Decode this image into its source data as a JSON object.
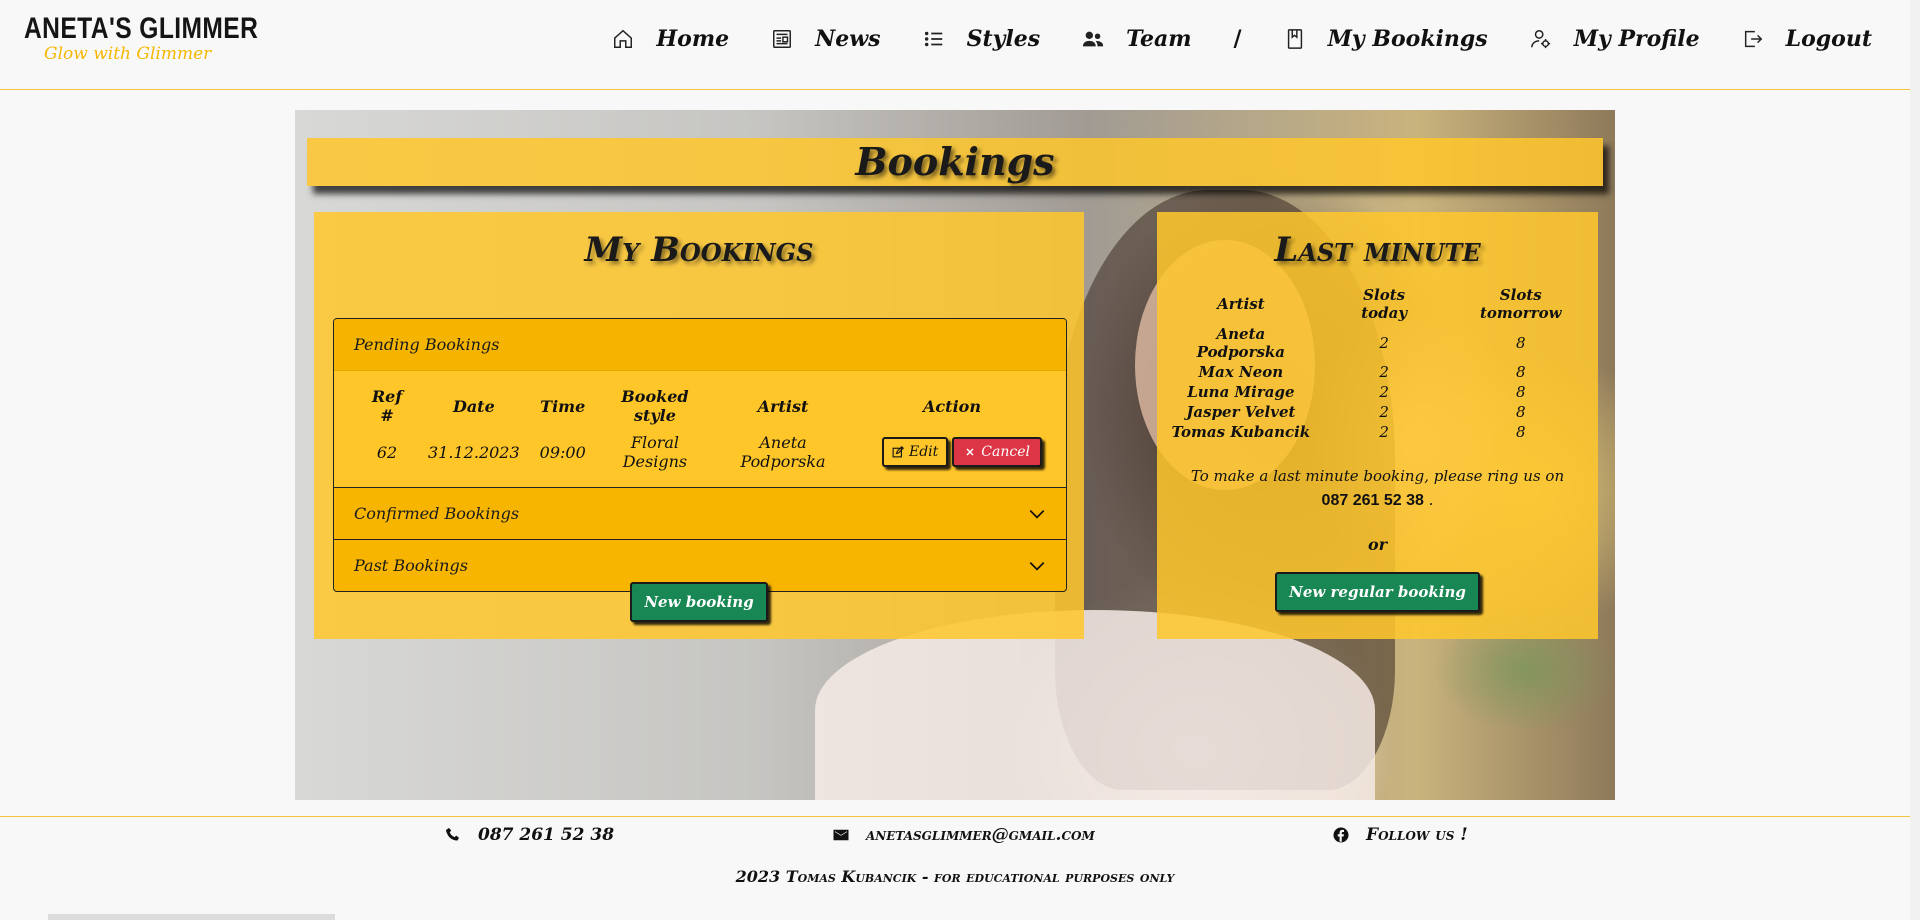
{
  "brand": {
    "name": "ANETA'S GLIMMER",
    "tagline": "Glow with Glimmer"
  },
  "nav": {
    "items": [
      {
        "label": "Home",
        "icon": "home-icon"
      },
      {
        "label": "News",
        "icon": "newspaper-icon"
      },
      {
        "label": "Styles",
        "icon": "list-icon"
      },
      {
        "label": "Team",
        "icon": "people-icon"
      }
    ],
    "separator": "/",
    "user_items": [
      {
        "label": "My Bookings",
        "icon": "bookmark-book-icon"
      },
      {
        "label": "My Profile",
        "icon": "person-gear-icon"
      },
      {
        "label": "Logout",
        "icon": "logout-icon"
      }
    ]
  },
  "page": {
    "title": "Bookings"
  },
  "my_bookings": {
    "heading": "My Bookings",
    "sections": {
      "pending": "Pending Bookings",
      "confirmed": "Confirmed Bookings",
      "past": "Past Bookings"
    },
    "columns": [
      "Ref #",
      "Date",
      "Time",
      "Booked style",
      "Artist",
      "Action"
    ],
    "rows": [
      {
        "ref": "62",
        "date": "31.12.2023",
        "time": "09:00",
        "style": "Floral Designs",
        "artist": "Aneta Podporska"
      }
    ],
    "edit_label": "Edit",
    "cancel_label": "Cancel",
    "new_booking_label": "New booking"
  },
  "last_minute": {
    "heading": "Last minute",
    "columns": [
      "Artist",
      "Slots today",
      "Slots tomorrow"
    ],
    "rows": [
      {
        "artist": "Aneta Podporska",
        "today": "2",
        "tomorrow": "8"
      },
      {
        "artist": "Max Neon",
        "today": "2",
        "tomorrow": "8"
      },
      {
        "artist": "Luna Mirage",
        "today": "2",
        "tomorrow": "8"
      },
      {
        "artist": "Jasper Velvet",
        "today": "2",
        "tomorrow": "8"
      },
      {
        "artist": "Tomas Kubancik",
        "today": "2",
        "tomorrow": "8"
      }
    ],
    "note": "To make a last minute booking, please ring us on",
    "phone": "087 261 52 38",
    "note_end": ".",
    "or_label": "or",
    "regular_booking_label": "New regular booking"
  },
  "footer": {
    "phone": "087 261 52 38",
    "email": "anetasglimmer@gmail.com",
    "follow": "Follow us !",
    "copyright": "2023 Tomas Kubancik - for educational purposes only"
  },
  "colors": {
    "accent": "#f5b400",
    "panel": "#ffc72c",
    "success": "#198754",
    "danger": "#dc3545"
  }
}
